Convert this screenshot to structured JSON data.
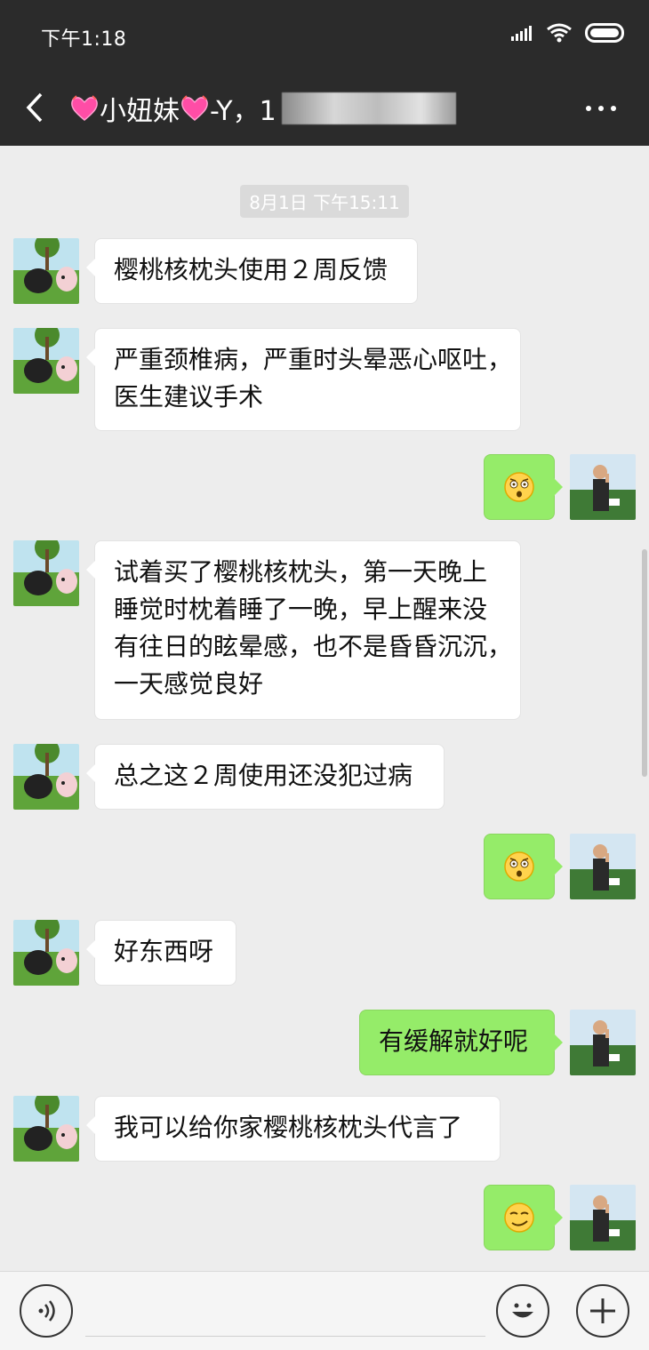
{
  "status": {
    "time": "下午1:18"
  },
  "header": {
    "title_name": "小妞妹",
    "title_suffix": "-Y，1",
    "icons": [
      "back-arrow-icon",
      "heart-icon",
      "more-dots-icon"
    ]
  },
  "chat": {
    "timestamp": "8月1日 下午15:11",
    "messages": [
      {
        "side": "left",
        "type": "text",
        "lines": [
          "樱桃核枕头使用２周反馈"
        ]
      },
      {
        "side": "left",
        "type": "text",
        "lines": [
          "严重颈椎病，严重时头晕恶心呕吐，",
          "医生建议手术"
        ]
      },
      {
        "side": "right",
        "type": "emoji",
        "emoji": "surprised-face-icon"
      },
      {
        "side": "left",
        "type": "text",
        "lines": [
          "试着买了樱桃核枕头，第一天晚上",
          "睡觉时枕着睡了一晚，早上醒来没",
          "有往日的眩晕感，也不是昏昏沉沉，",
          "一天感觉良好"
        ]
      },
      {
        "side": "left",
        "type": "text",
        "lines": [
          "总之这２周使用还没犯过病"
        ]
      },
      {
        "side": "right",
        "type": "emoji",
        "emoji": "surprised-face-icon"
      },
      {
        "side": "left",
        "type": "text",
        "lines": [
          "好东西呀"
        ]
      },
      {
        "side": "right",
        "type": "text",
        "lines": [
          "有缓解就好呢"
        ]
      },
      {
        "side": "left",
        "type": "text",
        "lines": [
          "我可以给你家樱桃核枕头代言了"
        ]
      },
      {
        "side": "right",
        "type": "emoji",
        "emoji": "smirk-face-icon"
      }
    ]
  },
  "input_bar": {
    "icons": [
      "voice-icon",
      "emoji-icon",
      "plus-icon"
    ]
  },
  "colors": {
    "header_bg": "#2b2b2b",
    "chat_bg": "#ededed",
    "self_bubble": "#95ec69",
    "other_bubble": "#ffffff"
  }
}
